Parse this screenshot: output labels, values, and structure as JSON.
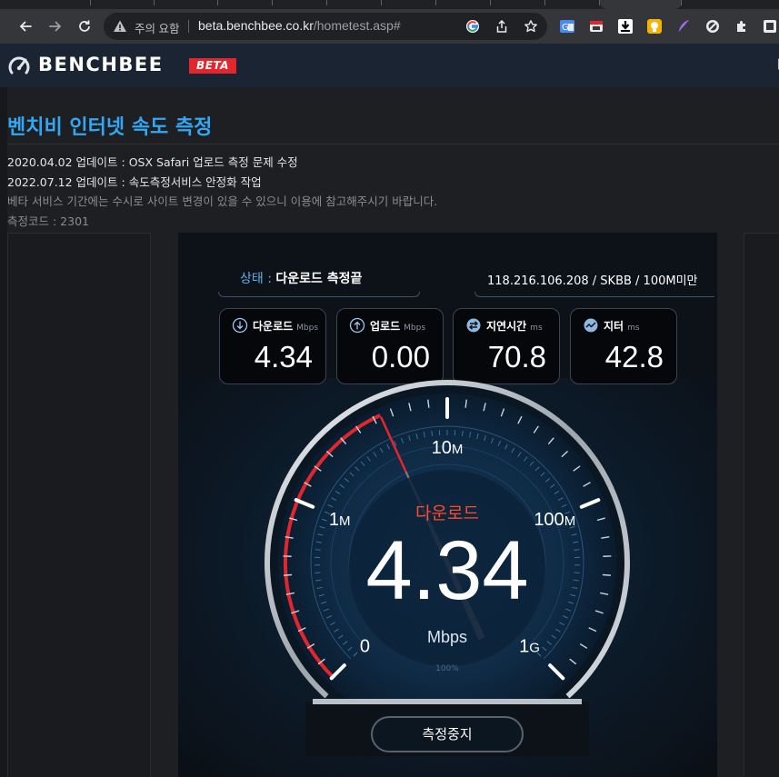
{
  "browser": {
    "security_label": "주의 요함",
    "url_host": "beta.benchbee.co.kr",
    "url_path": "/hometest.asp#"
  },
  "site": {
    "logo_text": "BENCHBEE",
    "beta_badge": "BETA",
    "header_edge_glyph": "▐"
  },
  "page": {
    "title": "벤치비 인터넷 속도 측정",
    "notices": [
      "2020.04.02 업데이트 : OSX Safari 업로드 측정 문제 수정",
      "2022.07.12 업데이트 : 속도측정서비스 안정화 작업",
      "베타 서비스 기간에는 수시로 사이트 변경이 있을 수 있으니 이용에 참고해주시기 바랍니다.",
      "측정코드 : 2301"
    ]
  },
  "test": {
    "status_label": "상태 : ",
    "status_value": "다운로드 측정끝",
    "isp_info": "118.216.106.208 / SKBB / 100M미만",
    "metrics": [
      {
        "label": "다운로드",
        "unit": "Mbps",
        "value": "4.34",
        "icon": "download-arrow-icon"
      },
      {
        "label": "업로드",
        "unit": "Mbps",
        "value": "0.00",
        "icon": "upload-arrow-icon"
      },
      {
        "label": "지연시간",
        "unit": "ms",
        "value": "70.8",
        "icon": "latency-swap-icon"
      },
      {
        "label": "지터",
        "unit": "ms",
        "value": "42.8",
        "icon": "jitter-wave-icon"
      }
    ],
    "gauge": {
      "mode_label": "다운로드",
      "value": "4.34",
      "unit": "Mbps",
      "progress_text": "100%",
      "scale_labels": [
        {
          "main": "0",
          "suffix": ""
        },
        {
          "main": "1",
          "suffix": "M"
        },
        {
          "main": "10",
          "suffix": "M"
        },
        {
          "main": "100",
          "suffix": "M"
        },
        {
          "main": "1",
          "suffix": "G"
        }
      ],
      "needle_mbps": 4.34,
      "accent_color": "#e2262e",
      "mode_color": "#ff4a2b"
    },
    "stop_button_label": "측정중지"
  }
}
